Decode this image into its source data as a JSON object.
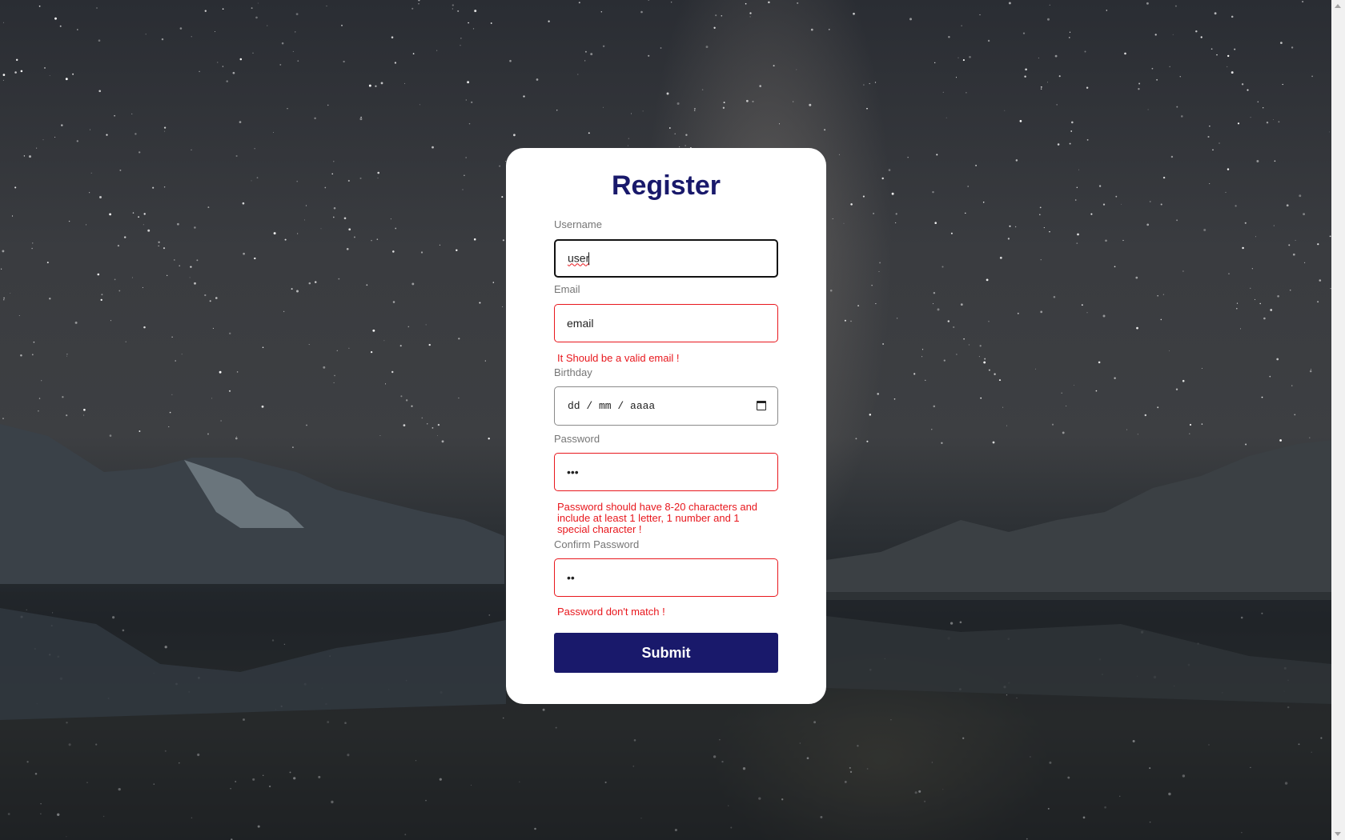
{
  "form": {
    "title": "Register",
    "username": {
      "label": "Username",
      "value": "user"
    },
    "email": {
      "label": "Email",
      "value": "email",
      "error": "It Should be a valid email !"
    },
    "birthday": {
      "label": "Birthday",
      "placeholder": "dd / mm / aaaa"
    },
    "password": {
      "label": "Password",
      "masked_value": "•••",
      "error": "Password should have 8-20 characters and include at least 1 letter, 1 number and 1 special character !"
    },
    "confirm_password": {
      "label": "Confirm Password",
      "masked_value": "••",
      "error": "Password don't match !"
    },
    "submit_label": "Submit"
  },
  "colors": {
    "accent": "#19196b",
    "error": "#e8171d",
    "label": "#767676",
    "card": "#ffffff"
  }
}
